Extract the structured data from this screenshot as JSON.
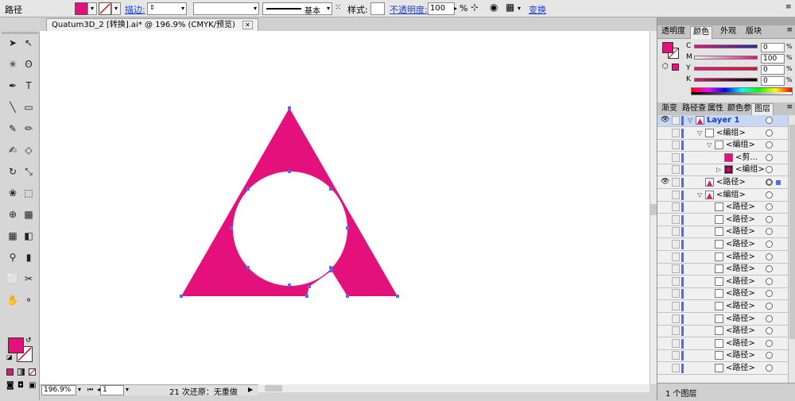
{
  "control_bar": {
    "object_type": "路径",
    "fill_color": "#e4117c",
    "stroke_label": "描边:",
    "stroke_weight": "",
    "brush_profile": "基本",
    "style_label": "样式:",
    "opacity_label": "不透明度:",
    "opacity_value": "100",
    "opacity_unit": "%",
    "transform_label": "变换"
  },
  "document": {
    "tab_title": "Quatum3D_2 [转换].ai* @ 196.9% (CMYK/预览)"
  },
  "canvas": {
    "shape_color": "#e4117c",
    "anchor_color": "#4a6ef5"
  },
  "status_bar": {
    "zoom": "196.9%",
    "artboard": "1",
    "undo_info": "21 次还原：无重做"
  },
  "panels": {
    "top_tabs": [
      "透明度",
      "颜色",
      "外观",
      "版块"
    ],
    "active_top_tab": "颜色",
    "color": {
      "swatch": "#e4117c",
      "channels": [
        {
          "label": "C",
          "value": "0"
        },
        {
          "label": "M",
          "value": "100"
        },
        {
          "label": "Y",
          "value": "0"
        },
        {
          "label": "K",
          "value": "0"
        }
      ]
    },
    "mid_tabs": [
      "渐变",
      "路径查",
      "属性",
      "颜色参",
      "图层"
    ],
    "active_mid_tab": "图层",
    "layers": [
      {
        "name": "Layer 1",
        "indent": 0,
        "eye": true,
        "expanded": true,
        "header": true
      },
      {
        "name": "<编组>",
        "indent": 1,
        "eye": false,
        "expanded": true
      },
      {
        "name": "<编组>",
        "indent": 2,
        "eye": false,
        "expanded": true
      },
      {
        "name": "<剪...",
        "indent": 3,
        "eye": false,
        "thumb": "pink"
      },
      {
        "name": "<编组>",
        "indent": 3,
        "eye": false,
        "collapsed": true,
        "thumb": "dark"
      },
      {
        "name": "<路径>",
        "indent": 1,
        "eye": true,
        "selected": true
      },
      {
        "name": "<编组>",
        "indent": 1,
        "eye": false,
        "expanded": true
      },
      {
        "name": "<路径>",
        "indent": 2
      },
      {
        "name": "<路径>",
        "indent": 2
      },
      {
        "name": "<路径>",
        "indent": 2
      },
      {
        "name": "<路径>",
        "indent": 2
      },
      {
        "name": "<路径>",
        "indent": 2
      },
      {
        "name": "<路径>",
        "indent": 2
      },
      {
        "name": "<路径>",
        "indent": 2
      },
      {
        "name": "<路径>",
        "indent": 2
      },
      {
        "name": "<路径>",
        "indent": 2
      },
      {
        "name": "<路径>",
        "indent": 2
      },
      {
        "name": "<路径>",
        "indent": 2
      },
      {
        "name": "<路径>",
        "indent": 2
      },
      {
        "name": "<路径>",
        "indent": 2
      },
      {
        "name": "<路径>",
        "indent": 2
      }
    ],
    "layers_footer": "1 个图层"
  },
  "tools": [
    "selection",
    "direct-selection",
    "magic-wand",
    "lasso",
    "pen",
    "type",
    "line",
    "rectangle",
    "paintbrush",
    "pencil",
    "blob-brush",
    "eraser",
    "rotate",
    "scale",
    "warp",
    "free-transform",
    "shape-builder",
    "perspective",
    "mesh",
    "gradient",
    "eyedropper",
    "graph",
    "artboard",
    "slice",
    "hand",
    "zoom"
  ]
}
